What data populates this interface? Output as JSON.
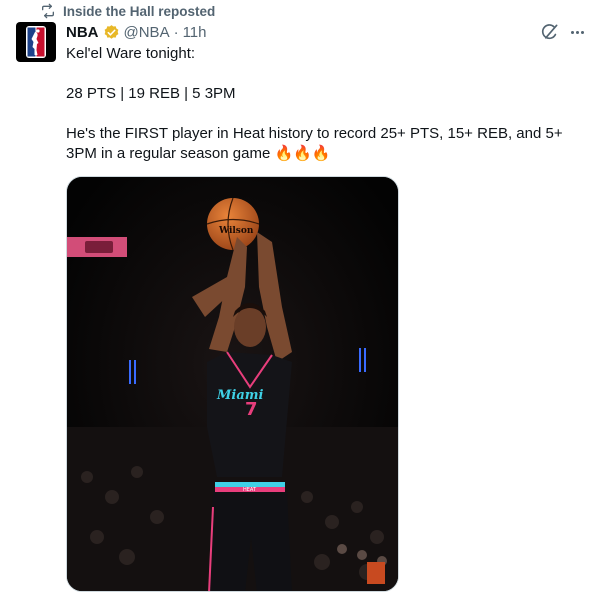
{
  "repost": {
    "label": "Inside the Hall reposted",
    "icon": "repost-icon"
  },
  "author": {
    "name": "NBA",
    "handle": "@NBA",
    "separator": "·",
    "time": "11h",
    "verified_badge_color": "#E8B828",
    "avatar_icon": "nba-logo-icon"
  },
  "tweet": {
    "line1": "Kel'el Ware tonight:",
    "line2": "28 PTS | 19 REB | 5 3PM",
    "line3": "He's the FIRST player in Heat history to record 25+ PTS, 15+ REB, and 5+",
    "line4": "3PM in a regular season game",
    "emoji": "🔥🔥🔥"
  },
  "media": {
    "ball_text": "Wilson",
    "jersey_text": "Miami",
    "jersey_number": "7",
    "shorts_text": "HEAT"
  },
  "colors": {
    "accent": "#1d9bf0",
    "muted": "#536471",
    "text": "#0f1419",
    "jersey_pink": "#e83e7c",
    "jersey_cyan": "#3fd1e6"
  }
}
